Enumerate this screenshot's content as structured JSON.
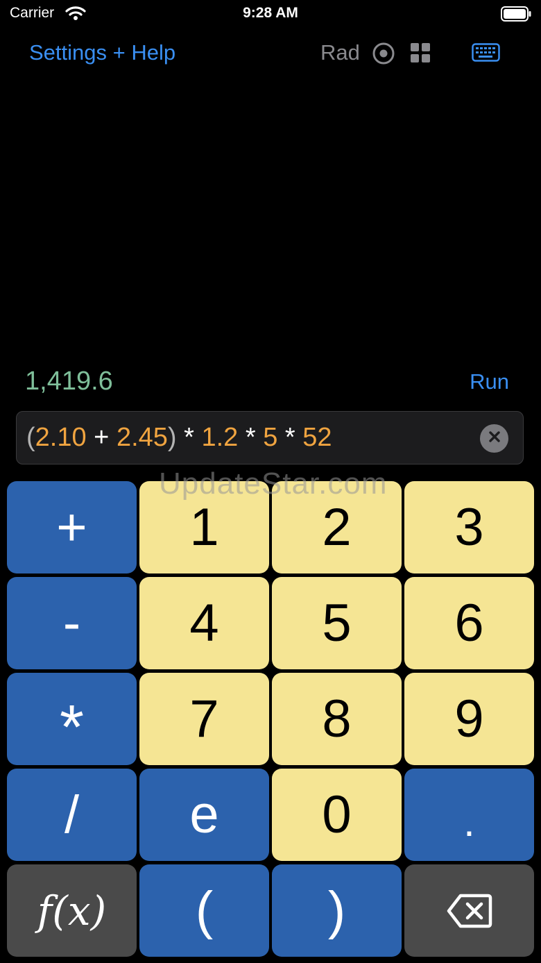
{
  "status_bar": {
    "carrier": "Carrier",
    "time": "9:28 AM"
  },
  "toolbar": {
    "settings_label": "Settings + Help",
    "angle_mode": "Rad",
    "icons": [
      "radio-button-icon",
      "grid-icon",
      "keyboard-icon"
    ]
  },
  "result": {
    "value": "1,419.6",
    "run_label": "Run"
  },
  "expression": {
    "tokens": [
      {
        "text": "(",
        "kind": "paren"
      },
      {
        "text": "2.10",
        "kind": "number"
      },
      {
        "text": " + ",
        "kind": "operator"
      },
      {
        "text": "2.45",
        "kind": "number"
      },
      {
        "text": ")",
        "kind": "paren"
      },
      {
        "text": " * ",
        "kind": "operator"
      },
      {
        "text": "1.2",
        "kind": "number"
      },
      {
        "text": " * ",
        "kind": "operator"
      },
      {
        "text": "5",
        "kind": "number"
      },
      {
        "text": " * ",
        "kind": "operator"
      },
      {
        "text": "52",
        "kind": "number"
      }
    ]
  },
  "watermark": "UpdateStar.com",
  "keypad": [
    {
      "label": "+",
      "style": "blue",
      "name": "key-plus"
    },
    {
      "label": "1",
      "style": "yellow",
      "name": "key-1"
    },
    {
      "label": "2",
      "style": "yellow",
      "name": "key-2"
    },
    {
      "label": "3",
      "style": "yellow",
      "name": "key-3"
    },
    {
      "label": "-",
      "style": "blue",
      "name": "key-minus"
    },
    {
      "label": "4",
      "style": "yellow",
      "name": "key-4"
    },
    {
      "label": "5",
      "style": "yellow",
      "name": "key-5"
    },
    {
      "label": "6",
      "style": "yellow",
      "name": "key-6"
    },
    {
      "label": "*",
      "style": "blue",
      "name": "key-multiply"
    },
    {
      "label": "7",
      "style": "yellow",
      "name": "key-7"
    },
    {
      "label": "8",
      "style": "yellow",
      "name": "key-8"
    },
    {
      "label": "9",
      "style": "yellow",
      "name": "key-9"
    },
    {
      "label": "/",
      "style": "blue",
      "name": "key-divide"
    },
    {
      "label": "e",
      "style": "blue",
      "name": "key-e"
    },
    {
      "label": "0",
      "style": "yellow",
      "name": "key-0"
    },
    {
      "label": ".",
      "style": "blue",
      "name": "key-decimal"
    },
    {
      "label": "f(x)",
      "style": "gray",
      "name": "key-function"
    },
    {
      "label": "(",
      "style": "blue",
      "name": "key-open-paren"
    },
    {
      "label": ")",
      "style": "blue",
      "name": "key-close-paren"
    },
    {
      "label": "",
      "style": "gray",
      "name": "key-backspace",
      "icon": "backspace-icon"
    }
  ],
  "colors": {
    "accent": "#3a8ff2",
    "result": "#7fbf9a",
    "number": "#f0a440",
    "key_blue": "#2c62ad",
    "key_yellow": "#f5e594",
    "key_gray": "#4a4a4a"
  }
}
